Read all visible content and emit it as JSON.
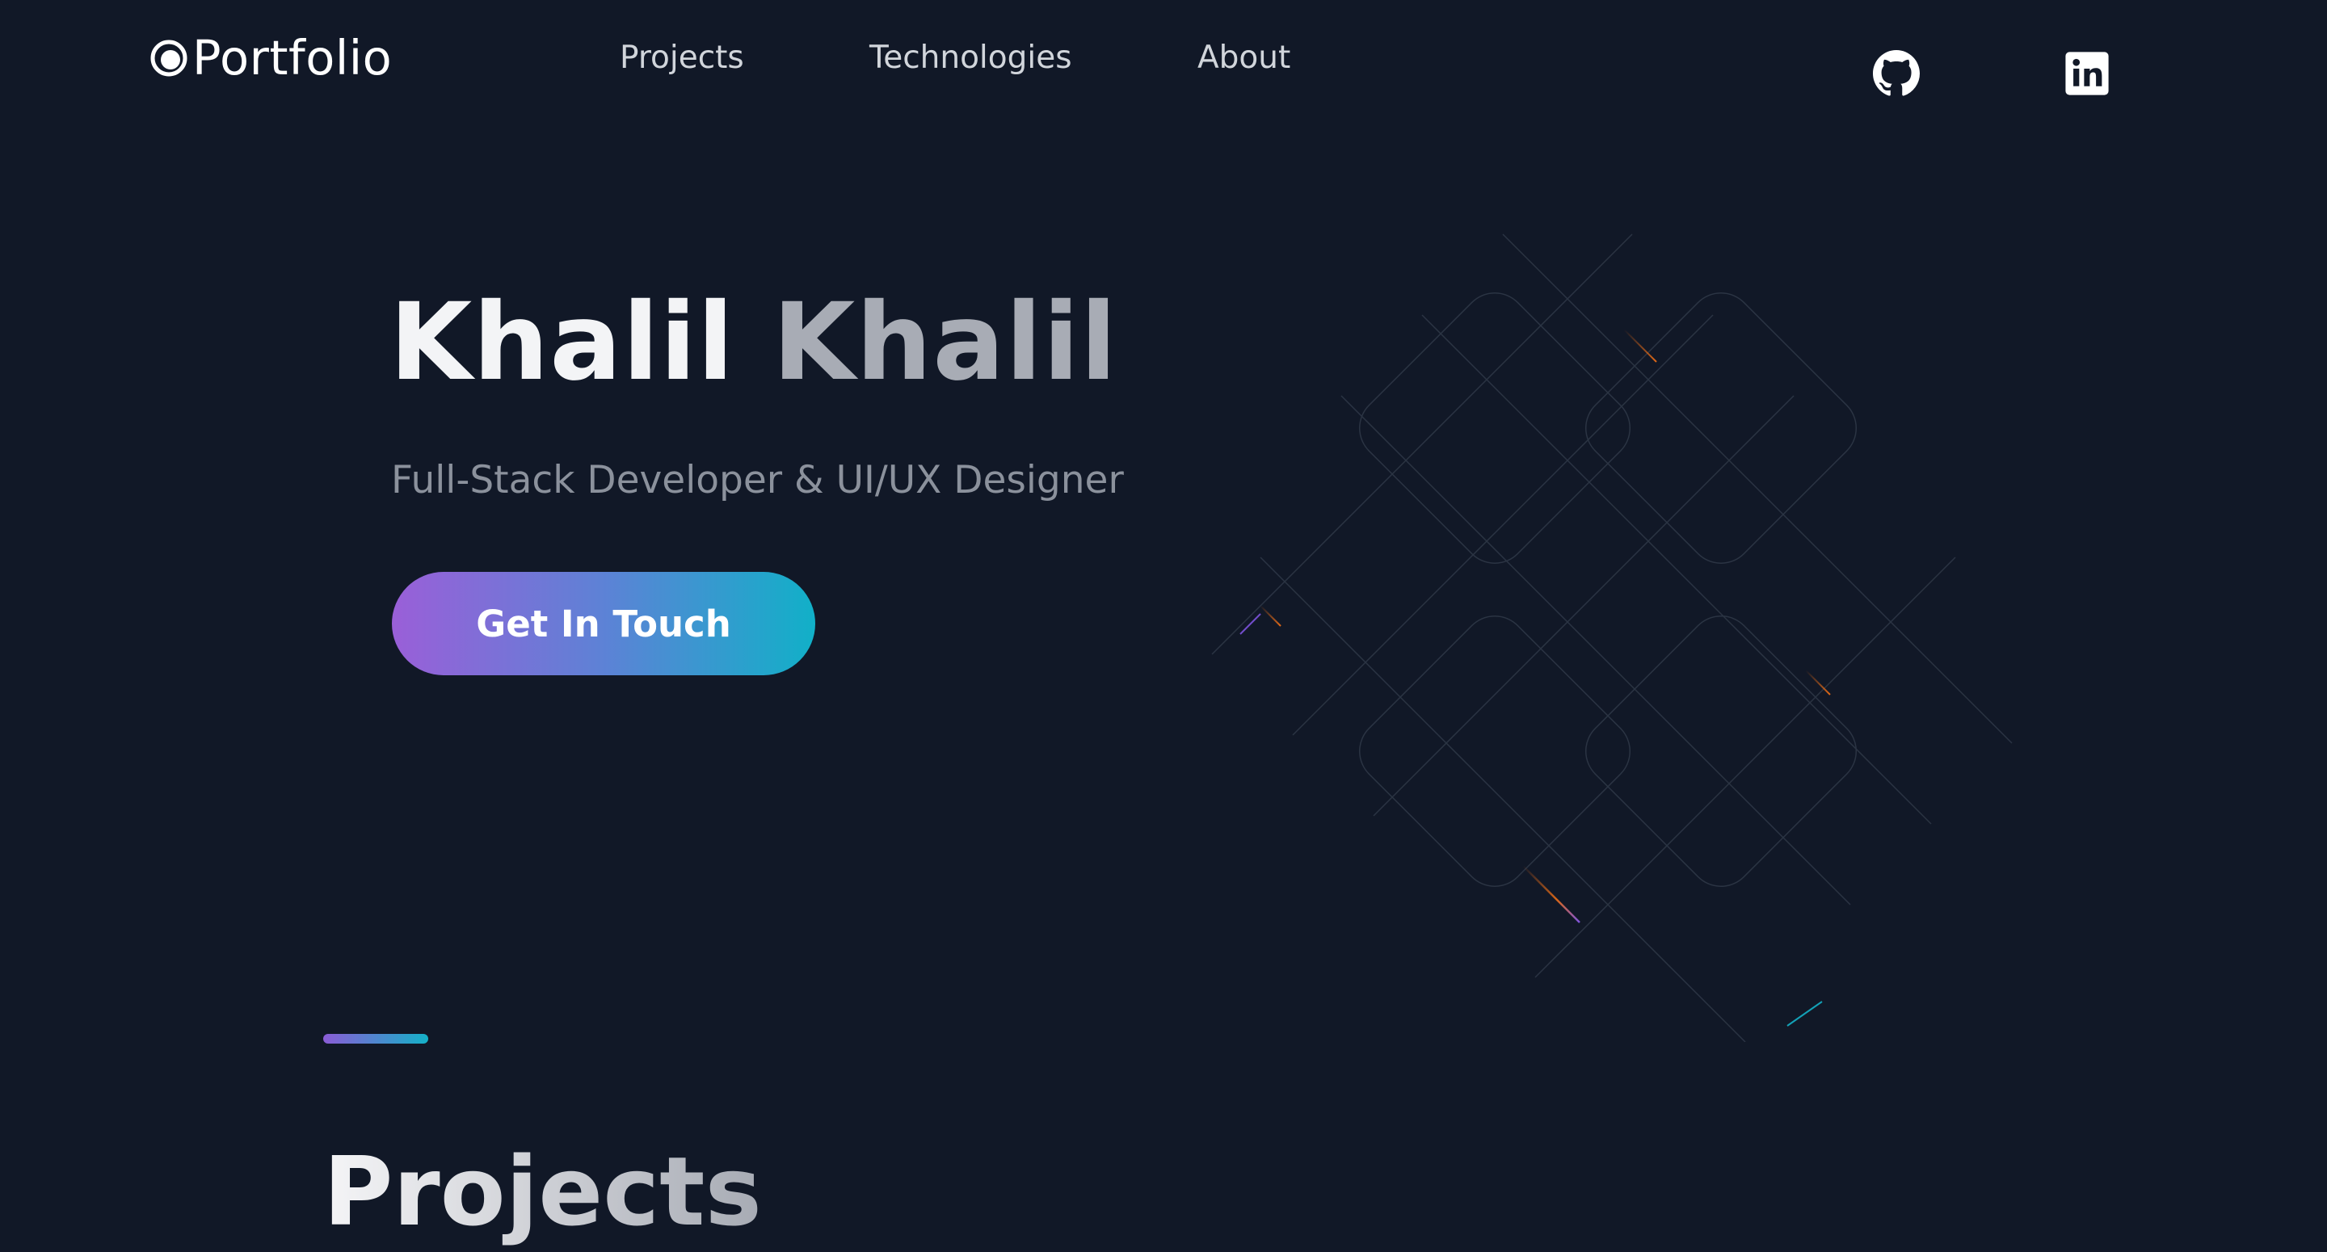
{
  "header": {
    "logo_text": "Portfolio",
    "nav": [
      {
        "label": "Projects"
      },
      {
        "label": "Technologies"
      },
      {
        "label": "About"
      }
    ],
    "social": [
      "github-icon",
      "linkedin-icon"
    ]
  },
  "hero": {
    "first_name": "Khalil",
    "last_name": "Khalil",
    "subtitle": "Full-Stack Developer & UI/UX Designer",
    "cta_label": "Get In Touch"
  },
  "projects": {
    "title": "Projects"
  },
  "colors": {
    "background": "#111827",
    "gradient_start": "#9a5fd8",
    "gradient_end": "#11b0c8",
    "muted_text": "#8b919c"
  }
}
